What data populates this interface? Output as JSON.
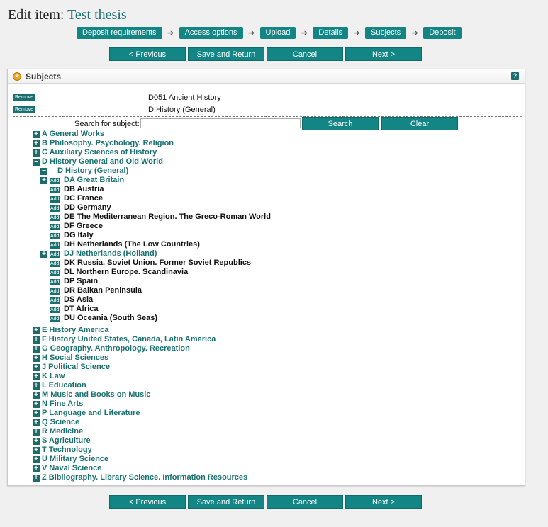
{
  "page": {
    "title_prefix": "Edit item:",
    "item_name": "Test thesis"
  },
  "workflow": {
    "steps": [
      "Deposit requirements",
      "Access options",
      "Upload",
      "Details",
      "Subjects",
      "Deposit"
    ],
    "arrow": "➔"
  },
  "nav_buttons": {
    "previous": "< Previous",
    "save_return": "Save and Return",
    "cancel": "Cancel",
    "next": "Next >"
  },
  "panel": {
    "title": "Subjects",
    "help": "?",
    "remove_label": "Remove",
    "selected": [
      "D051 Ancient History",
      "D History (General)"
    ],
    "search_label": "Search for subject:",
    "search_value": "",
    "search_button": "Search",
    "clear_button": "Clear",
    "add_label": "Add",
    "plus": "+",
    "minus": "−"
  },
  "tree": {
    "top_before": [
      "A General Works",
      "B Philosophy. Psychology. Religion",
      "C Auxiliary Sciences of History",
      "D History General and Old World"
    ],
    "d_general": "D History (General)",
    "d_children": [
      {
        "label": "DA Great Britain",
        "expandable": true
      },
      {
        "label": "DB Austria",
        "expandable": false
      },
      {
        "label": "DC France",
        "expandable": false
      },
      {
        "label": "DD Germany",
        "expandable": false
      },
      {
        "label": "DE The Mediterranean Region. The Greco-Roman World",
        "expandable": false
      },
      {
        "label": "DF Greece",
        "expandable": false
      },
      {
        "label": "DG Italy",
        "expandable": false
      },
      {
        "label": "DH Netherlands (The Low Countries)",
        "expandable": false
      },
      {
        "label": "DJ Netherlands (Holland)",
        "expandable": true
      },
      {
        "label": "DK Russia. Soviet Union. Former Soviet Republics",
        "expandable": false
      },
      {
        "label": "DL Northern Europe. Scandinavia",
        "expandable": false
      },
      {
        "label": "DP Spain",
        "expandable": false
      },
      {
        "label": "DR Balkan Peninsula",
        "expandable": false
      },
      {
        "label": "DS Asia",
        "expandable": false
      },
      {
        "label": "DT Africa",
        "expandable": false
      },
      {
        "label": "DU Oceania (South Seas)",
        "expandable": false
      }
    ],
    "top_after": [
      "E History America",
      "F History United States, Canada, Latin America",
      "G Geography. Anthropology. Recreation",
      "H Social Sciences",
      "J Political Science",
      "K Law",
      "L Education",
      "M Music and Books on Music",
      "N Fine Arts",
      "P Language and Literature",
      "Q Science",
      "R Medicine",
      "S Agriculture",
      "T Technology",
      "U Military Science",
      "V Naval Science",
      "Z Bibliography. Library Science. Information Resources"
    ]
  },
  "colors": {
    "accent": "#148585",
    "link": "#1a7070",
    "background": "#f0f0f0"
  }
}
